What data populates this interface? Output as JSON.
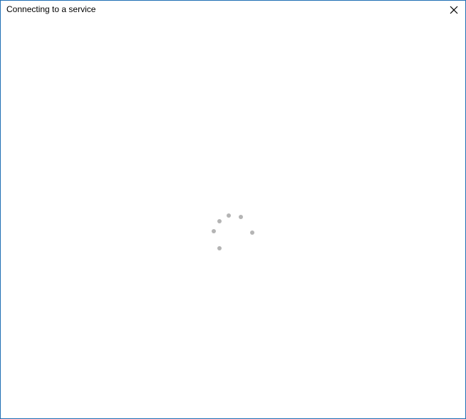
{
  "window": {
    "title": "Connecting to a service",
    "border_color": "#1f6fb4",
    "background": "#ffffff"
  },
  "titlebar": {
    "close_icon": "close-icon"
  },
  "spinner": {
    "icon": "loading-spinner-icon",
    "dot_color": "#b4b4b4",
    "dot_count": 6
  }
}
